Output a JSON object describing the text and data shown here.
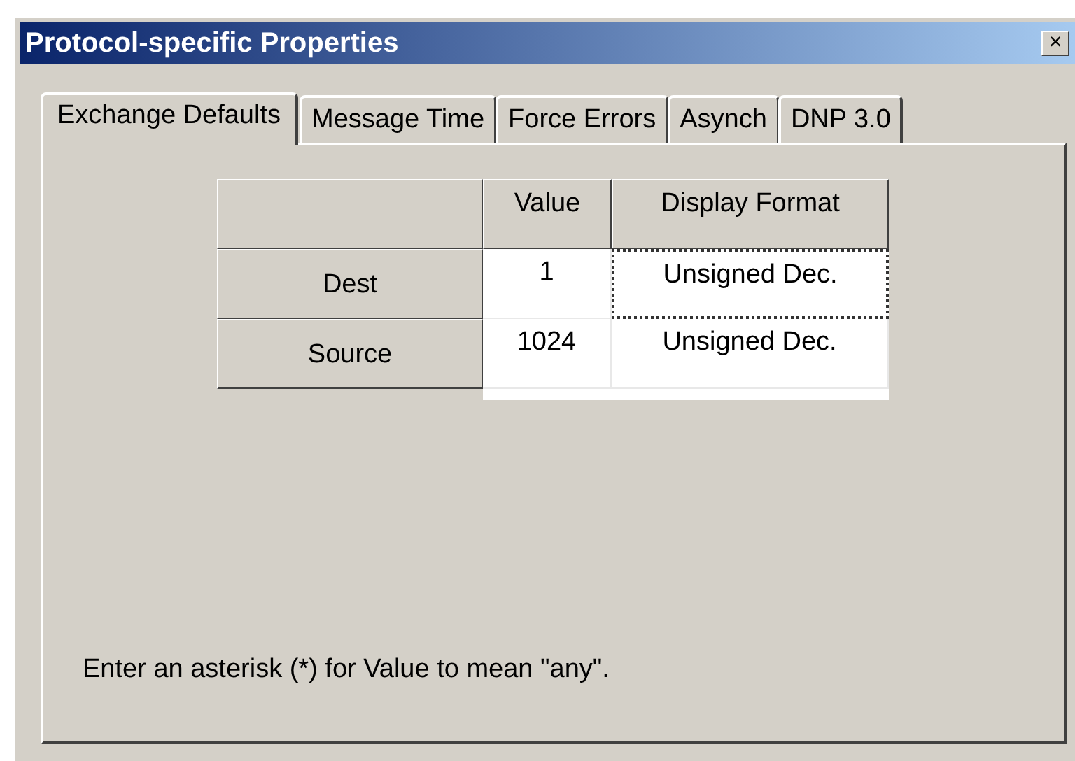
{
  "window": {
    "title": "Protocol-specific Properties",
    "close": "×"
  },
  "tabs": [
    {
      "label": "Exchange Defaults",
      "selected": true
    },
    {
      "label": "Message Time",
      "selected": false
    },
    {
      "label": "Force Errors",
      "selected": false
    },
    {
      "label": "Asynch",
      "selected": false
    },
    {
      "label": "DNP 3.0",
      "selected": false
    }
  ],
  "table": {
    "columns": [
      "Value",
      "Display Format"
    ],
    "rows": [
      {
        "label": "Dest",
        "value": "1",
        "format": "Unsigned Dec.",
        "focused": true
      },
      {
        "label": "Source",
        "value": "1024",
        "format": "Unsigned Dec.",
        "focused": false
      }
    ]
  },
  "note": "Enter an asterisk (*) for Value to mean \"any\"."
}
